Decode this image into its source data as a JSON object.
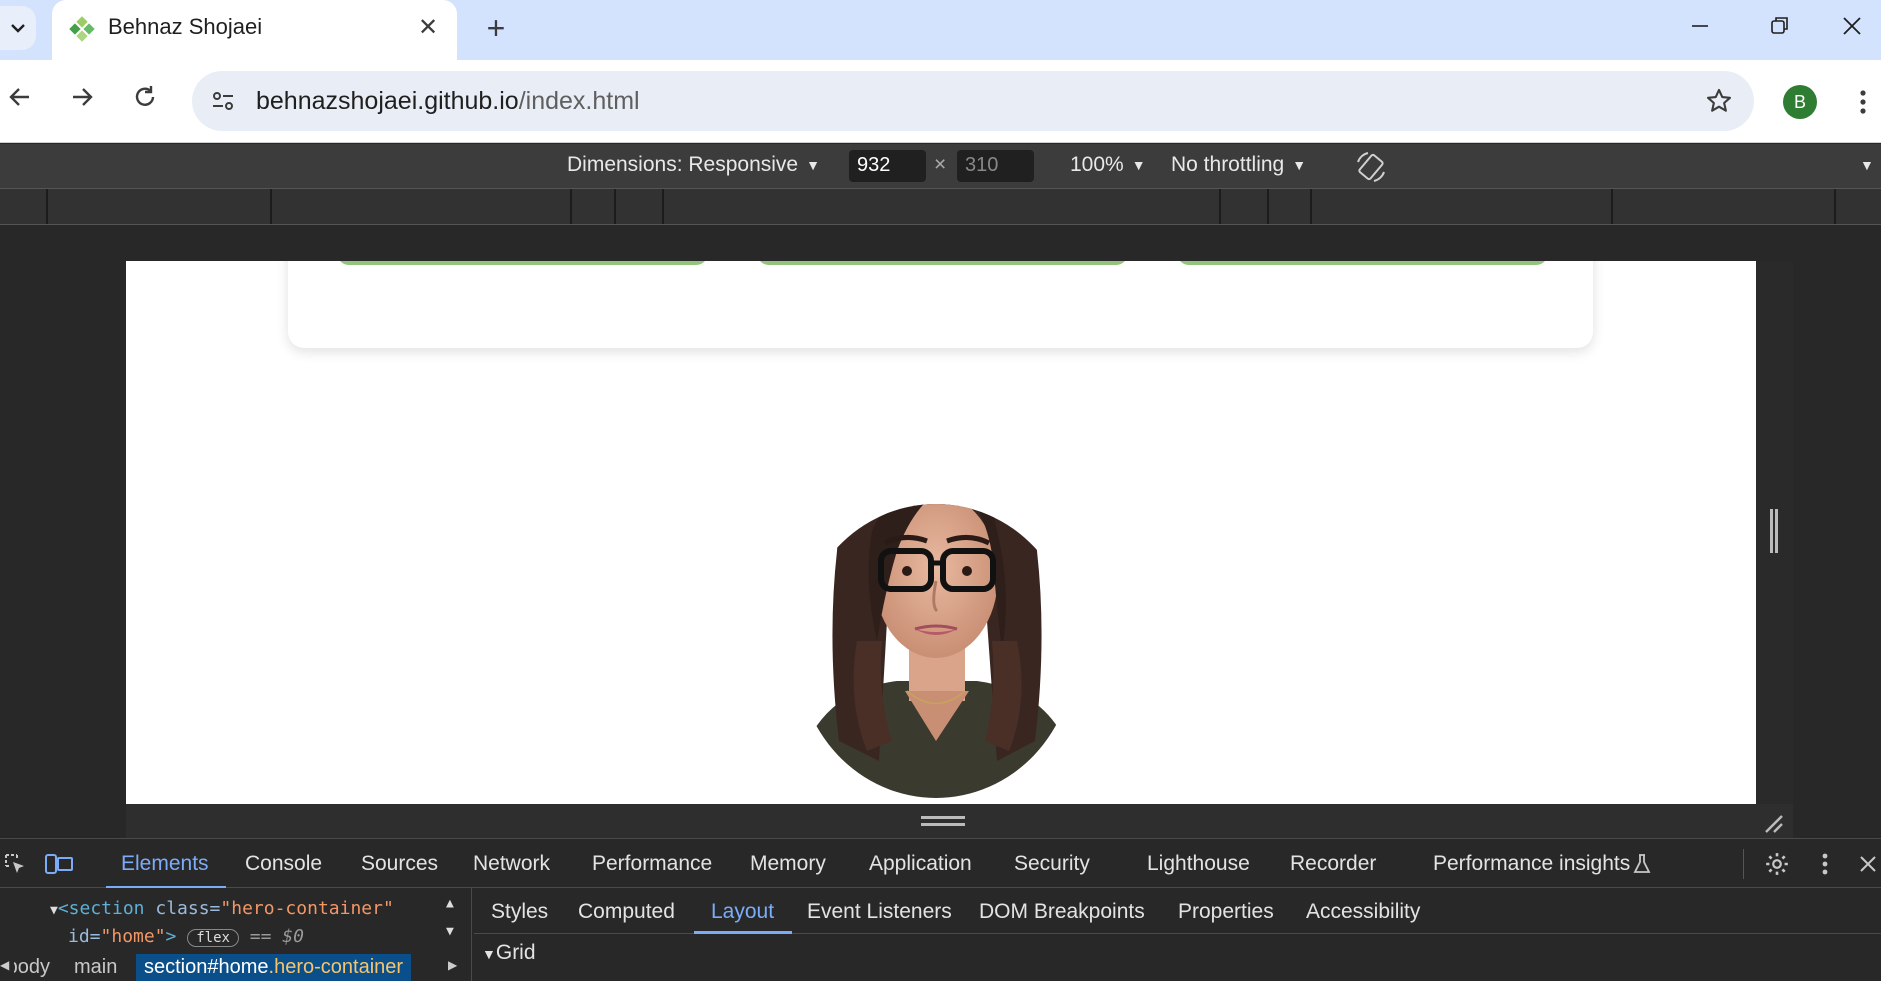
{
  "browser": {
    "tab_title": "Behnaz Shojaei",
    "new_tab": "+",
    "url_host": "behnazshojaei.github.io",
    "url_path": "/index.html",
    "profile_initial": "B"
  },
  "device_toolbar": {
    "dimensions_label": "Dimensions: Responsive",
    "width": "932",
    "separator": "×",
    "height": "310",
    "zoom": "100%",
    "throttling": "No throttling"
  },
  "devtools": {
    "tabs": [
      "Elements",
      "Console",
      "Sources",
      "Network",
      "Performance",
      "Memory",
      "Application",
      "Security",
      "Lighthouse",
      "Recorder",
      "Performance insights"
    ],
    "active_tab": "Elements",
    "dom": {
      "tag_open": "<section",
      "attr_class": "class=",
      "val_class": "\"hero-container\"",
      "attr_id": "id=",
      "val_id": "\"home\"",
      "tag_close": ">",
      "badge": "flex",
      "selected_marker": "== $0"
    },
    "breadcrumbs": {
      "body": "body",
      "main": "main",
      "section_tag": "section",
      "section_id": "#home",
      "section_class": ".hero-container"
    },
    "sidebar_tabs": [
      "Styles",
      "Computed",
      "Layout",
      "Event Listeners",
      "DOM Breakpoints",
      "Properties",
      "Accessibility"
    ],
    "active_sidebar_tab": "Layout",
    "section_label": "Grid"
  },
  "page": {
    "accent_button_color": "#93c47d"
  }
}
